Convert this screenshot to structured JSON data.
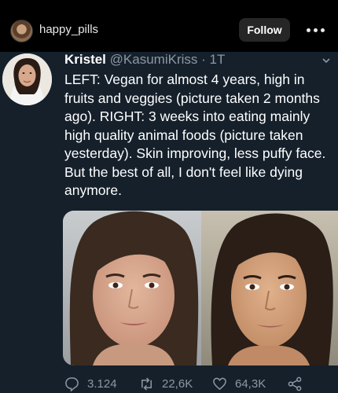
{
  "header": {
    "username": "happy_pills",
    "follow_label": "Follow"
  },
  "tweet": {
    "name": "Kristel",
    "handle": "@KasumiKriss",
    "separator": "·",
    "time": "1T",
    "text": "LEFT: Vegan for almost 4 years, high in fruits and veggies (picture taken 2 months ago). RIGHT: 3 weeks into eating mainly high quality animal foods (picture taken yesterday). Skin improving, less puffy face. But the best of all, I don't feel like dying anymore."
  },
  "actions": {
    "replies": "3.124",
    "retweets": "22,6K",
    "likes": "64,3K"
  },
  "icons": [
    "more-icon",
    "chevron-down-icon",
    "reply-icon",
    "retweet-icon",
    "like-icon",
    "share-icon"
  ],
  "colors": {
    "background": "#15202b",
    "topbar": "#000000",
    "secondary_text": "#8b98a5"
  }
}
